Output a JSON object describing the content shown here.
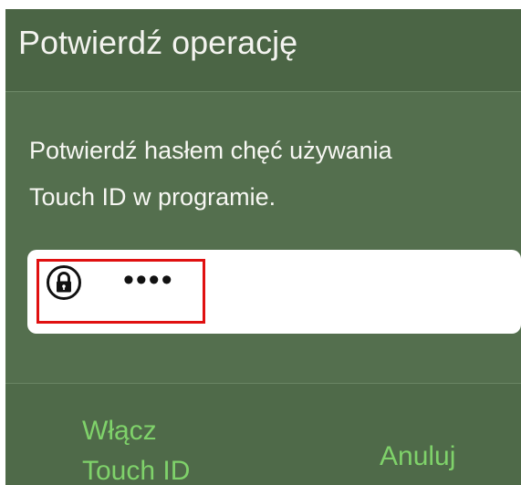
{
  "dialog": {
    "title": "Potwierdź operację",
    "message_lines": [
      "Potwierdź hasłem chęć używania",
      "Touch ID w programie."
    ],
    "password_field": {
      "icon": "lock-icon",
      "masked_value": "••••"
    },
    "buttons": {
      "enable_touch_id_lines": [
        "Włącz",
        "Touch ID"
      ],
      "cancel": "Anuluj"
    }
  },
  "colors": {
    "dialog_background": "#546f4e",
    "title_bar": "#4b6545",
    "button_text": "#7fd26a",
    "highlight_border": "#e01010"
  }
}
